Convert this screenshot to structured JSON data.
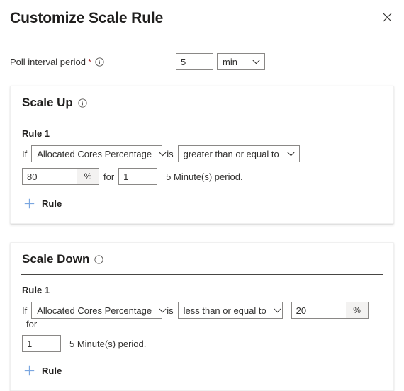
{
  "header": {
    "title": "Customize Scale Rule",
    "close_icon": "close-icon"
  },
  "poll": {
    "label": "Poll interval period",
    "required_mark": "*",
    "info_icon": "info-icon",
    "value": "5",
    "unit": "min",
    "unit_options": [
      "min"
    ]
  },
  "scale_up": {
    "title": "Scale Up",
    "info_icon": "info-icon",
    "rule_label": "Rule 1",
    "if_word": "If",
    "is_word": "is",
    "for_word": "for",
    "metric": "Allocated Cores Percentage",
    "metric_options": [
      "Allocated Cores Percentage"
    ],
    "operator": "greater than or equal to",
    "operator_options": [
      "greater than or equal to"
    ],
    "threshold": "80",
    "threshold_unit": "%",
    "period_count": "1",
    "period_text": "5 Minute(s) period.",
    "add_rule_label": "Rule",
    "add_icon": "plus-icon"
  },
  "scale_down": {
    "title": "Scale Down",
    "info_icon": "info-icon",
    "rule_label": "Rule 1",
    "if_word": "If",
    "is_word": "is",
    "for_word": "for",
    "metric": "Allocated Cores Percentage",
    "metric_options": [
      "Allocated Cores Percentage"
    ],
    "operator": "less than or equal to",
    "operator_options": [
      "less than or equal to"
    ],
    "threshold": "20",
    "threshold_unit": "%",
    "period_count": "1",
    "period_text": "5 Minute(s) period.",
    "add_rule_label": "Rule",
    "add_icon": "plus-icon"
  },
  "colors": {
    "accent": "#0078d4",
    "add_plus": "#7aa6e0",
    "required": "#a4262c",
    "text": "#323130",
    "divider": "#484644"
  }
}
